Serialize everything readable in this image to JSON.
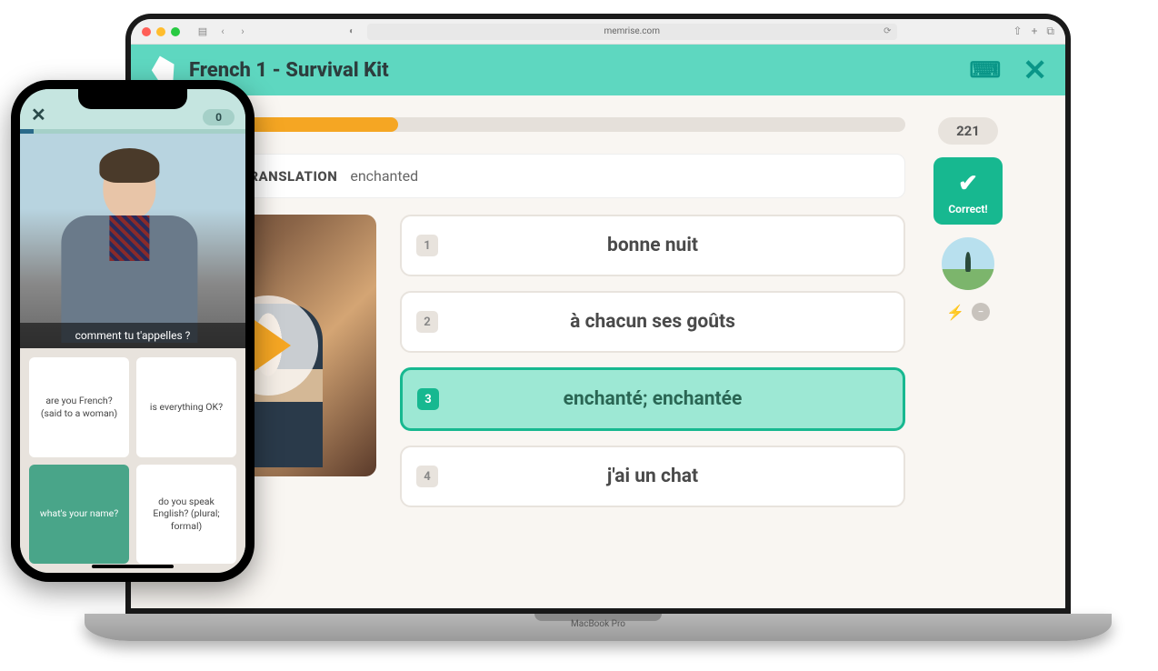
{
  "macbook": {
    "label": "MacBook Pro",
    "browser": {
      "url": "memrise.com"
    }
  },
  "desktop": {
    "header": {
      "title": "French 1 - Survival Kit"
    },
    "progress": {
      "percent": 32,
      "score": "221"
    },
    "prompt": {
      "label": "LITERAL TRANSLATION",
      "word": "enchanted"
    },
    "options": [
      {
        "num": "1",
        "text": "bonne nuit",
        "correct": false
      },
      {
        "num": "2",
        "text": "à chacun ses goûts",
        "correct": false
      },
      {
        "num": "3",
        "text": "enchanté; enchantée",
        "correct": true
      },
      {
        "num": "4",
        "text": "j'ai un chat",
        "correct": false
      }
    ],
    "feedback": "Correct!"
  },
  "mobile": {
    "score": "0",
    "caption": "comment tu t'appelles ?",
    "options": [
      {
        "text": "are you French? (said to a woman)",
        "selected": false
      },
      {
        "text": "is everything OK?",
        "selected": false
      },
      {
        "text": "what's your name?",
        "selected": true
      },
      {
        "text": "do you speak English? (plural; formal)",
        "selected": false
      }
    ]
  }
}
